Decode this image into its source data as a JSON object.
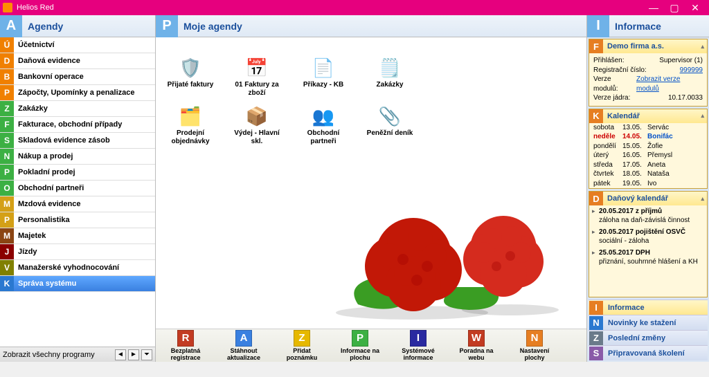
{
  "app_title": "Helios Red",
  "left_panel": {
    "header_letter": "A",
    "header_color": "#6fb2e8",
    "title": "Agendy",
    "items": [
      {
        "letter": "Ú",
        "color": "#f08000",
        "label": "Účetnictví"
      },
      {
        "letter": "D",
        "color": "#f08000",
        "label": "Daňová evidence"
      },
      {
        "letter": "B",
        "color": "#f08000",
        "label": "Bankovní operace"
      },
      {
        "letter": "P",
        "color": "#f08000",
        "label": "Zápočty, Upomínky a penalizace"
      },
      {
        "letter": "Z",
        "color": "#3cb043",
        "label": "Zakázky"
      },
      {
        "letter": "F",
        "color": "#3cb043",
        "label": "Fakturace, obchodní případy"
      },
      {
        "letter": "S",
        "color": "#3cb043",
        "label": "Skladová evidence zásob"
      },
      {
        "letter": "N",
        "color": "#3cb043",
        "label": "Nákup a prodej"
      },
      {
        "letter": "P",
        "color": "#3cb043",
        "label": "Pokladní prodej"
      },
      {
        "letter": "O",
        "color": "#3cb043",
        "label": "Obchodní partneři"
      },
      {
        "letter": "M",
        "color": "#d4a017",
        "label": "Mzdová evidence"
      },
      {
        "letter": "P",
        "color": "#d4a017",
        "label": "Personalistika"
      },
      {
        "letter": "M",
        "color": "#8b4513",
        "label": "Majetek"
      },
      {
        "letter": "J",
        "color": "#8B0000",
        "label": "Jízdy"
      },
      {
        "letter": "V",
        "color": "#808000",
        "label": "Manažerské vyhodnocování"
      },
      {
        "letter": "K",
        "color": "#2a78d0",
        "label": "Správa systému",
        "active": true
      }
    ],
    "status_text": "Zobrazit všechny programy"
  },
  "center_panel": {
    "header_letter": "P",
    "header_color": "#6fb2e8",
    "title": "Moje agendy",
    "icons": [
      {
        "name": "prijate-faktury",
        "label": "Přijaté faktury",
        "glyph": "🛡️"
      },
      {
        "name": "faktury-za-zbozi",
        "label": "01 Faktury za zboží",
        "glyph": "📅"
      },
      {
        "name": "prikazy-kb",
        "label": "Příkazy - KB",
        "glyph": "📄"
      },
      {
        "name": "zakazky",
        "label": "Zakázky",
        "glyph": "🗒️"
      },
      {
        "name": "prodejni-objednavky",
        "label": "Prodejní objednávky",
        "glyph": "🗂️"
      },
      {
        "name": "vydej-hlavni-skl",
        "label": "Výdej - Hlavní skl.",
        "glyph": "📦"
      },
      {
        "name": "obchodni-partneri",
        "label": "Obchodní partneři",
        "glyph": "👥"
      },
      {
        "name": "penezni-denik",
        "label": "Peněžní deník",
        "glyph": "📎"
      }
    ],
    "toolbar": [
      {
        "letter": "R",
        "color": "#c23b22",
        "label": "Bezplatná registrace"
      },
      {
        "letter": "A",
        "color": "#3a80e0",
        "label": "Stáhnout aktualizace"
      },
      {
        "letter": "Z",
        "color": "#e6b800",
        "label": "Přidat poznámku"
      },
      {
        "letter": "P",
        "color": "#3cb043",
        "label": "Informace na plochu"
      },
      {
        "letter": "I",
        "color": "#2a2aa0",
        "label": "Systémové informace"
      },
      {
        "letter": "W",
        "color": "#c23b22",
        "label": "Poradna na webu"
      },
      {
        "letter": "N",
        "color": "#e67e22",
        "label": "Nastavení plochy"
      }
    ]
  },
  "right_panel": {
    "header_letter": "I",
    "header_color": "#6fb2e8",
    "title": "Informace",
    "firm": {
      "letter": "F",
      "color": "#e67e22",
      "title": "Demo firma a.s.",
      "rows": [
        {
          "k": "Přihlášen:",
          "v": "Supervisor  (1)"
        },
        {
          "k": "Registrační číslo:",
          "v": "999999",
          "link": true
        },
        {
          "k": "Verze modulů:",
          "v": "Zobrazit verze modulů",
          "link": true
        },
        {
          "k": "Verze jádra:",
          "v": "10.17.0033"
        }
      ]
    },
    "calendar": {
      "letter": "K",
      "color": "#e67e22",
      "title": "Kalendář",
      "rows": [
        {
          "day": "sobota",
          "date": "13.05.",
          "name": "Servác"
        },
        {
          "day": "neděle",
          "date": "14.05.",
          "name": "Bonifác",
          "hl": true,
          "hlb": true
        },
        {
          "day": "pondělí",
          "date": "15.05.",
          "name": "Žofie"
        },
        {
          "day": "úterý",
          "date": "16.05.",
          "name": "Přemysl"
        },
        {
          "day": "středa",
          "date": "17.05.",
          "name": "Aneta"
        },
        {
          "day": "čtvrtek",
          "date": "18.05.",
          "name": "Nataša"
        },
        {
          "day": "pátek",
          "date": "19.05.",
          "name": "Ivo"
        }
      ]
    },
    "tax": {
      "letter": "D",
      "color": "#e67e22",
      "title": "Daňový kalendář",
      "items": [
        {
          "head": "20.05.2017  z příjmů",
          "text": "záloha na daň-závislá činnost"
        },
        {
          "head": "20.05.2017  pojištění OSVČ",
          "text": "sociální - záloha"
        },
        {
          "head": "25.05.2017  DPH",
          "text": "přiznání, souhrnné hlášení a KH"
        }
      ]
    },
    "nav": [
      {
        "letter": "I",
        "color": "#e67e22",
        "label": "Informace",
        "active": true
      },
      {
        "letter": "N",
        "color": "#2a78d0",
        "label": "Novinky ke stažení"
      },
      {
        "letter": "Z",
        "color": "#6a7a8a",
        "label": "Poslední změny"
      },
      {
        "letter": "S",
        "color": "#8a5aa8",
        "label": "Připravovaná školení"
      }
    ]
  }
}
